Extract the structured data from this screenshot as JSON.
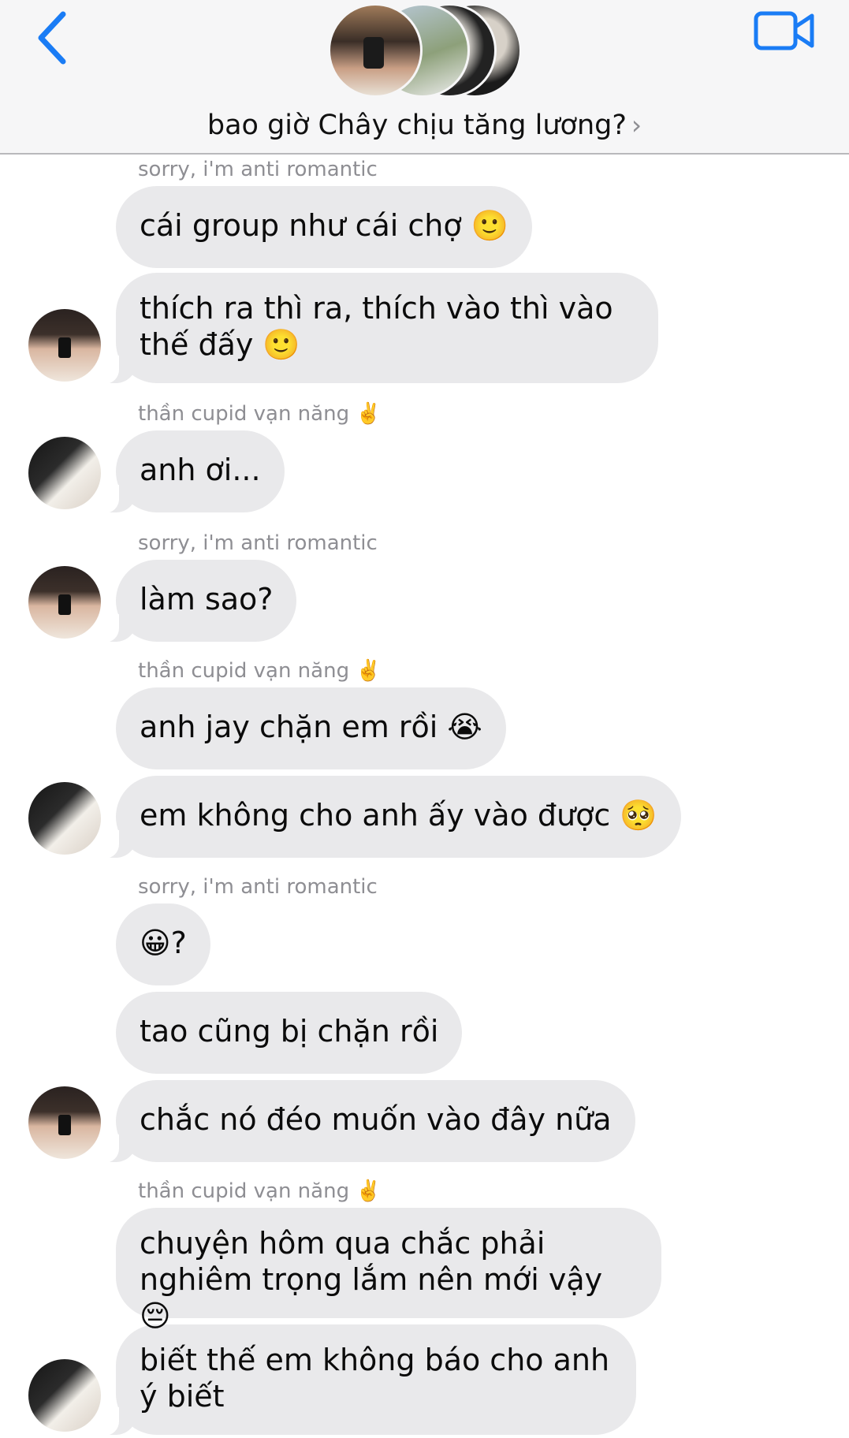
{
  "header": {
    "title": "bao giờ Chây chịu tăng lương?",
    "chevron": "›",
    "back_icon": "chevron-left-icon",
    "video_icon": "video-camera-icon",
    "accent_color": "#1a7cf5"
  },
  "messages": {
    "s1": "sorry, i'm anti romantic",
    "m1": "cái group như cái chợ 🙂",
    "m2": "thích ra thì ra, thích vào thì vào thế đấy 🙂",
    "s2": "thần cupid vạn năng ✌️",
    "m3": "anh ơi...",
    "s3": "sorry, i'm anti romantic",
    "m4": "làm sao?",
    "s4": "thần cupid vạn năng ✌️",
    "m5": "anh jay chặn em rồi 😭",
    "m6": "em không cho anh ấy vào được 🥺",
    "s5": "sorry, i'm anti romantic",
    "m7": "😀?",
    "m8": "tao cũng bị chặn rồi",
    "m9": "chắc nó đéo muốn vào đây nữa",
    "s6": "thần cupid vạn năng ✌️",
    "m10": "chuyện hôm qua chắc phải nghiêm trọng lắm nên mới vậy 😔",
    "m11": "biết thế em không báo cho anh ý biết"
  },
  "colors": {
    "bubble": "#e9e9eb",
    "sender_name": "#8e8e93",
    "header_bg": "#f6f6f7"
  }
}
